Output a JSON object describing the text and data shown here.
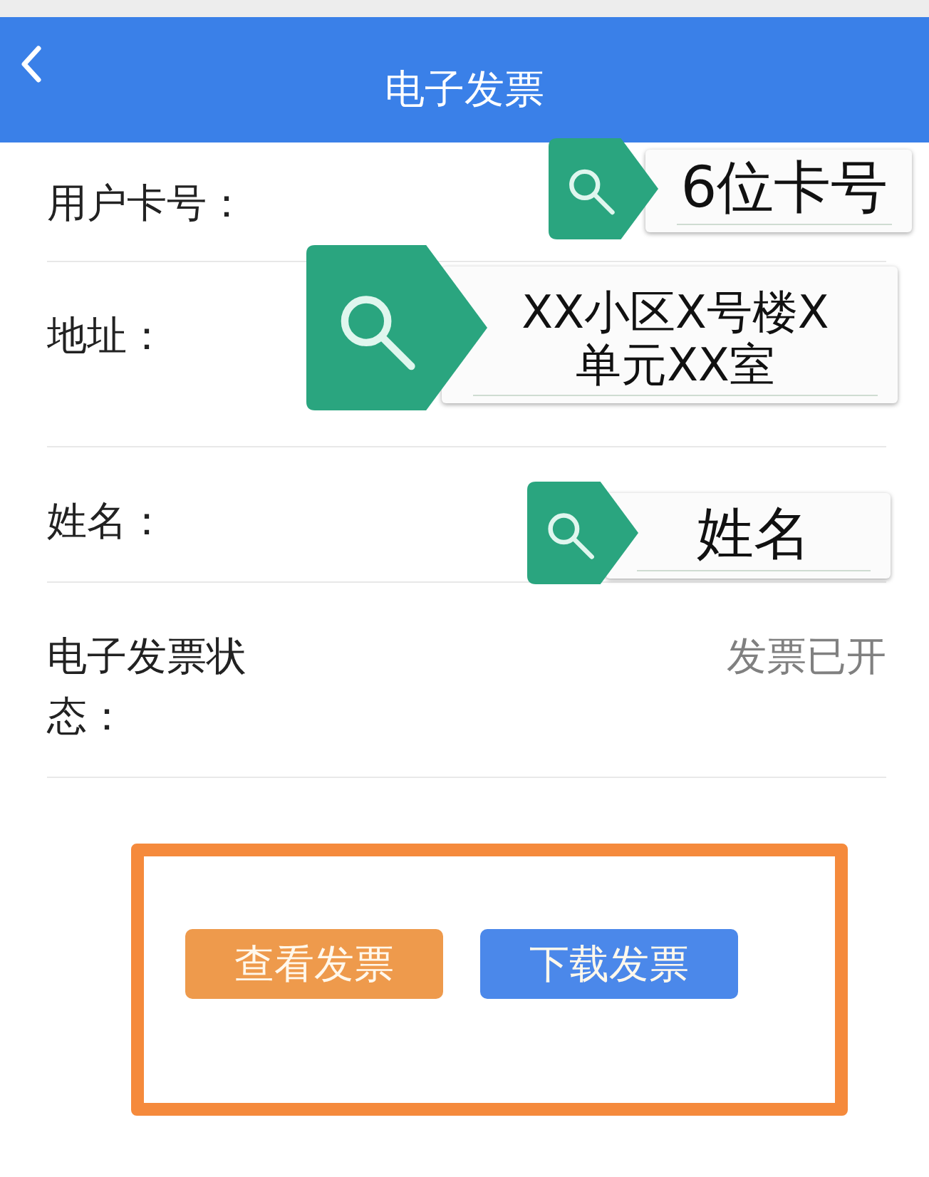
{
  "header": {
    "title": "电子发票"
  },
  "rows": [
    {
      "kind": "callout",
      "label": "用户卡号：",
      "callout": {
        "lines": [
          "6位卡号"
        ]
      }
    },
    {
      "kind": "callout",
      "label": "地址：",
      "callout": {
        "lines": [
          "XX小区X号楼X",
          "单元XX室"
        ]
      }
    },
    {
      "kind": "callout",
      "label": "姓名：",
      "callout": {
        "lines": [
          "姓名"
        ]
      }
    },
    {
      "kind": "value",
      "label": "电子发票状态：",
      "value": "发票已开"
    }
  ],
  "buttons": [
    {
      "label": "查看发票",
      "kind": "secondary"
    },
    {
      "label": "下载发票",
      "kind": "primary"
    }
  ]
}
